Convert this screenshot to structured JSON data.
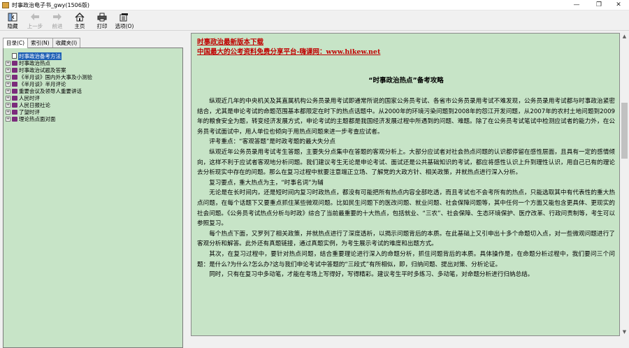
{
  "window": {
    "title": "时事政治电子书_gwy(1506版)",
    "controls": {
      "minimize": "—",
      "restore": "❐",
      "close": "✕"
    }
  },
  "toolbar": {
    "buttons": [
      {
        "label": "隐藏",
        "icon": "hide-icon",
        "enabled": true
      },
      {
        "label": "上一步",
        "icon": "back-arrow-icon",
        "enabled": false
      },
      {
        "label": "前进",
        "icon": "forward-arrow-icon",
        "enabled": false
      },
      {
        "label": "主页",
        "icon": "home-icon",
        "enabled": true
      },
      {
        "label": "打印",
        "icon": "print-icon",
        "enabled": true
      },
      {
        "label": "选项(O)",
        "icon": "options-icon",
        "enabled": true
      }
    ]
  },
  "sidebar": {
    "tabs": [
      "目录(C)",
      "索引(N)",
      "收藏夹(I)"
    ],
    "active_tab": 0,
    "tree": [
      {
        "label": "时事政治备考方法",
        "type": "page",
        "selected": true
      },
      {
        "label": "时事政治热点",
        "type": "book"
      },
      {
        "label": "时事政治试题及答案",
        "type": "book"
      },
      {
        "label": "《半月谈》国内外大事及小测验",
        "type": "book"
      },
      {
        "label": "《半月谈》半月评论",
        "type": "book"
      },
      {
        "label": "重要会议及领导人重要讲话",
        "type": "book"
      },
      {
        "label": "人民时评",
        "type": "book"
      },
      {
        "label": "人民日报社论",
        "type": "book"
      },
      {
        "label": "了望时评",
        "type": "book"
      },
      {
        "label": "理论热点面对面",
        "type": "book"
      }
    ]
  },
  "content": {
    "link1": "时事政治最新版本下载",
    "link2": "中国最大的公考资料免费分享平台-嗨课网：www.hikew.net",
    "title": "“时事政治热点”备考攻略",
    "paragraphs": [
      "纵观近几年的中央机关及其直属机构公务员录用考试即通常所说的国家公务员考试、各省市公务员录用考试不难发现，公务员录用考试都与时事政治紧密结合，尤其是申论考试的命题范围基本都限定在时下的热点话题中。从2000年的环境污染问题到2008年的怨江开发问题，从2007年的农村土地问题到2009年的粮食安全为题，转变经济发展方式，申论考试的主题都是我国经济发展过程中所遇到的问题、难题。除了在公务员考试笔试中检测应试者的能力外，在公务员考试面试中，用人单位也倾向于用热点问题来进一步考查应试者。",
      "评考重点：“客观答题”是时政考题的最大失分点",
      "纵观近年公务员录用考试考生答题，主要失分点集中在答题的客观分析上。大部分应试者对社会热点问题的认识都停留在感性层面，且具有一定的感情倾向，这样不利于应试者客观地分析问题。我们建议考生无论是申论考试、面试还是公共基础知识的考试，都应将感性认识上升到理性认识，用自己已有的理论去分析现实中存在的问题。那么在复习过程中就要注意端正立场、了解党的大政方针、相关政策，并就热点进行深入分析。",
      "复习要点，重大热点为主，“时事名词”为辅",
      "无论是在长时间内，还是短时间内复习时政热点，都没有可能把所有热点内容全部吃透，而且考试也不会考所有的热点，只能选取其中有代表性的重大热点问题，在每个话题下又要重点抓住某些微观问题。比如民生问题下的医改问题、就业问题、社会保障问题等，其中任何一个方面又能包含更具体、更现实的社会问题。《公务员考试热点分析与时政》综合了当前最重要的十大热点，包括就业、“三农”、社会保障、生态环境保护、医疗改革、行政问责制等，考生可以参照复习。",
      "每个热点下面，又罗列了相关政策，并就热点进行了深度透析，以揭示问题背后的本质。在此基础上又引申出十多个命题切入点，对一些微观问题进行了客观分析和解答。此外还有真题链接，通过真题实例，为考生展示考试的难度和出题方式。",
      "其次，在复习过程中，要针对热点问题，结合重要理论进行深入的命题分析，抓住问题背后的本质。具体操作是，在命题分析过程中，我们要问三个问题：是什么?为什么?怎么办?这与我们申论考试中答题的“三段式”有所相似，即，归纳问题、提出对策、分析论证。",
      "同时，只有在复习中多动笔，才能在考场上写得好，写得精彩。建议考生平时多练习、多动笔，对命题分析进行归纳总结。"
    ]
  },
  "colors": {
    "content_bg": "#c7e4c7",
    "link": "#c00000",
    "selection": "#1e5fb5",
    "book_icon": "#7b2c7b"
  }
}
